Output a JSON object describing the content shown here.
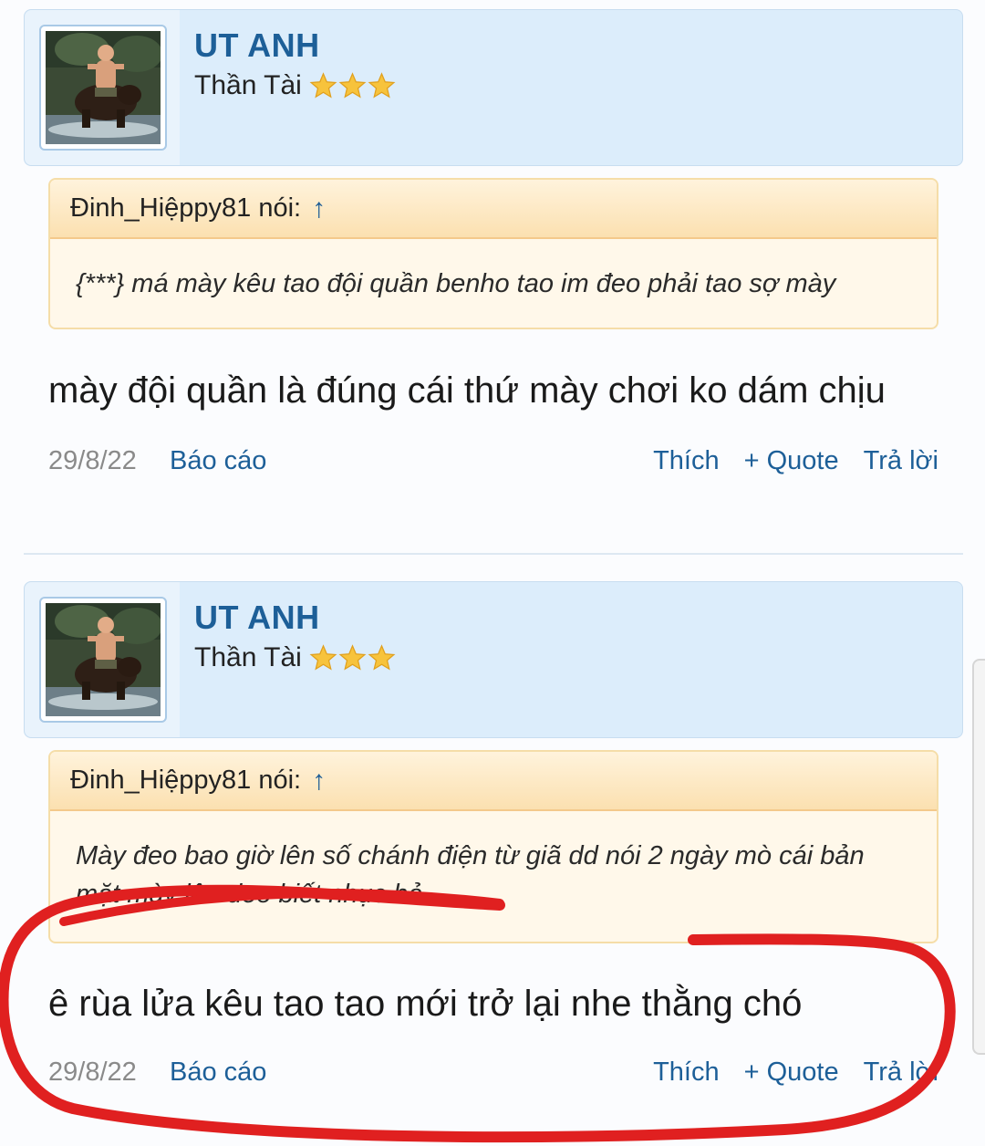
{
  "posts": [
    {
      "username": "UT ANH",
      "user_title": "Thần Tài",
      "stars": 3,
      "avatar": "avatar-photo-man-riding-bear",
      "quote": {
        "author": "Đinh_Hiệppy81 nói:",
        "arrow_icon": "↑",
        "text": "{***} má mày kêu tao đội quần benho tao im đeo phải tao sợ mày"
      },
      "message": "mày đội quần là đúng cái thứ mày chơi ko dám chịu",
      "date": "29/8/22",
      "report": "Báo cáo",
      "like": "Thích",
      "quote_action": "+ Quote",
      "reply": "Trả lời"
    },
    {
      "username": "UT ANH",
      "user_title": "Thần Tài",
      "stars": 3,
      "avatar": "avatar-photo-man-riding-bear",
      "quote": {
        "author": "Đinh_Hiệppy81 nói:",
        "arrow_icon": "↑",
        "text": "Mày đeo bao giờ lên số chánh điện từ giã dd nói 2 ngày mò cái bản mặt mày lên đeo biết nhục hả"
      },
      "message": "ê rùa lửa kêu tao tao mới trở lại nhe thằng chó",
      "date": "29/8/22",
      "report": "Báo cáo",
      "like": "Thích",
      "quote_action": "+ Quote",
      "reply": "Trả lời"
    }
  ],
  "colors": {
    "accent": "#1d5f98",
    "user_card_bg": "#dcedfb",
    "quote_bg": "#fff8ea",
    "annotation": "#e02020"
  }
}
